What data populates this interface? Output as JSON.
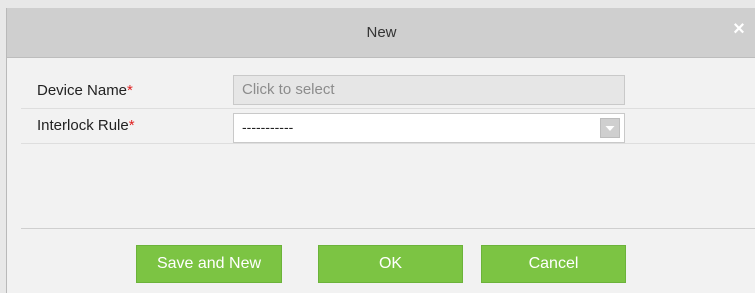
{
  "dialog": {
    "title": "New",
    "close_icon": "close-icon"
  },
  "form": {
    "device_name": {
      "label": "Device Name",
      "required_mark": "*",
      "value": "Click to select"
    },
    "interlock_rule": {
      "label": "Interlock Rule",
      "required_mark": "*",
      "selected": "-----------",
      "arrow_icon": "chevron-down-icon"
    }
  },
  "buttons": {
    "save_and_new": "Save and New",
    "ok": "OK",
    "cancel": "Cancel"
  },
  "colors": {
    "button_green": "#7cc443",
    "title_bar": "#cfcfcf",
    "required": "#e02020"
  }
}
